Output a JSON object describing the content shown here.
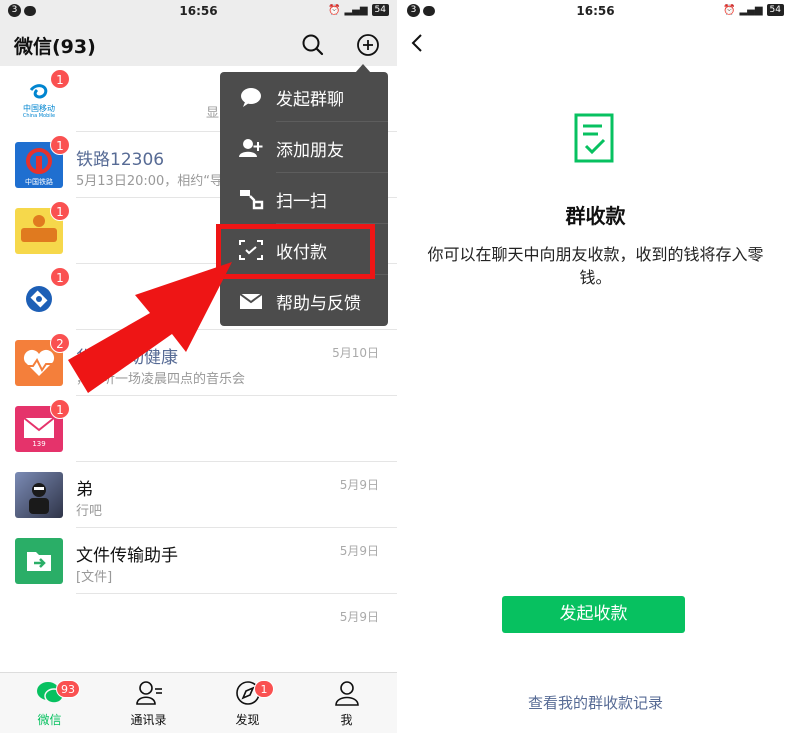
{
  "status_bar": {
    "left_badge": "3",
    "time": "16:56",
    "battery": "54"
  },
  "wechat": {
    "title": "微信(93)",
    "icons": [
      "search-icon",
      "plus-circle-icon"
    ],
    "chats": [
      {
        "name": "",
        "preview": "",
        "time": "",
        "unread": "1",
        "avatar": "china-mobile-logo",
        "logo_text": "中国移动",
        "logo_sub": "China Mobile",
        "peek_right": "显"
      },
      {
        "name": "铁路12306",
        "preview": "5月13日20:00，相约“导",
        "time": "",
        "unread": "1",
        "avatar": "railway-logo",
        "logo_text": "中国铁路"
      },
      {
        "name": "",
        "preview": "",
        "time": "",
        "unread": "1",
        "avatar": "yellow-avatar"
      },
      {
        "name": "",
        "preview": "",
        "time": "",
        "unread": "1",
        "avatar": "bank-logo"
      },
      {
        "name": "华为运动健康",
        "preview": "，来听一场凌晨四点的音乐会",
        "time": "5月10日",
        "unread": "2",
        "avatar": "health-logo"
      },
      {
        "name": "",
        "preview": "",
        "time": "",
        "unread": "1",
        "avatar": "mail139-logo",
        "logo_text": "139"
      },
      {
        "name": "弟",
        "preview": "行吧",
        "time": "5月9日",
        "unread": "",
        "avatar": "photo-avatar"
      },
      {
        "name": "文件传输助手",
        "preview": "[文件]",
        "time": "5月9日",
        "unread": "",
        "avatar": "file-transfer-logo"
      },
      {
        "name": "",
        "preview": "",
        "time": "5月9日",
        "unread": "",
        "avatar": ""
      }
    ],
    "menu": [
      {
        "label": "发起群聊",
        "icon": "chat-bubble-icon"
      },
      {
        "label": "添加朋友",
        "icon": "add-user-icon"
      },
      {
        "label": "扫一扫",
        "icon": "scan-icon"
      },
      {
        "label": "收付款",
        "icon": "payment-icon"
      },
      {
        "label": "帮助与反馈",
        "icon": "mail-icon"
      }
    ],
    "tabs": [
      {
        "label": "微信",
        "icon": "chat-icon",
        "badge": "93",
        "active": true
      },
      {
        "label": "通讯录",
        "icon": "contacts-icon",
        "badge": ""
      },
      {
        "label": "发现",
        "icon": "compass-icon",
        "badge": "1"
      },
      {
        "label": "我",
        "icon": "person-icon",
        "badge": ""
      }
    ],
    "colors": {
      "brand_green": "#07c160",
      "badge_red": "#fa5151",
      "menu_bg": "#4c4c4c",
      "highlight_red": "#ee1515",
      "link_blue": "#576b95"
    }
  },
  "group_payment": {
    "title": "群收款",
    "description": "你可以在聊天中向朋友收款，收到的钱将存入零钱。",
    "primary_button": "发起收款",
    "records_link": "查看我的群收款记录"
  }
}
